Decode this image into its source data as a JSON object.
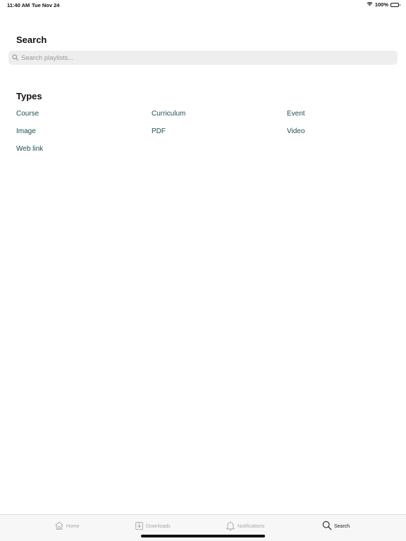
{
  "status_bar": {
    "time": "11:40 AM",
    "date": "Tue Nov 24",
    "battery": "100%"
  },
  "page": {
    "title": "Search"
  },
  "search": {
    "placeholder": "Search playlists..."
  },
  "types": {
    "heading": "Types",
    "items": [
      "Course",
      "Curriculum",
      "Event",
      "Image",
      "PDF",
      "Video",
      "Web link"
    ]
  },
  "tabbar": {
    "items": [
      {
        "label": "Home",
        "icon": "home-icon"
      },
      {
        "label": "Downloads",
        "icon": "download-icon"
      },
      {
        "label": "Notifications",
        "icon": "bell-icon"
      },
      {
        "label": "Search",
        "icon": "search-icon"
      }
    ],
    "active": "Search"
  },
  "colors": {
    "link": "#1f4d52",
    "tab_inactive": "#a8a8a8",
    "search_bg": "#eeeeef"
  }
}
